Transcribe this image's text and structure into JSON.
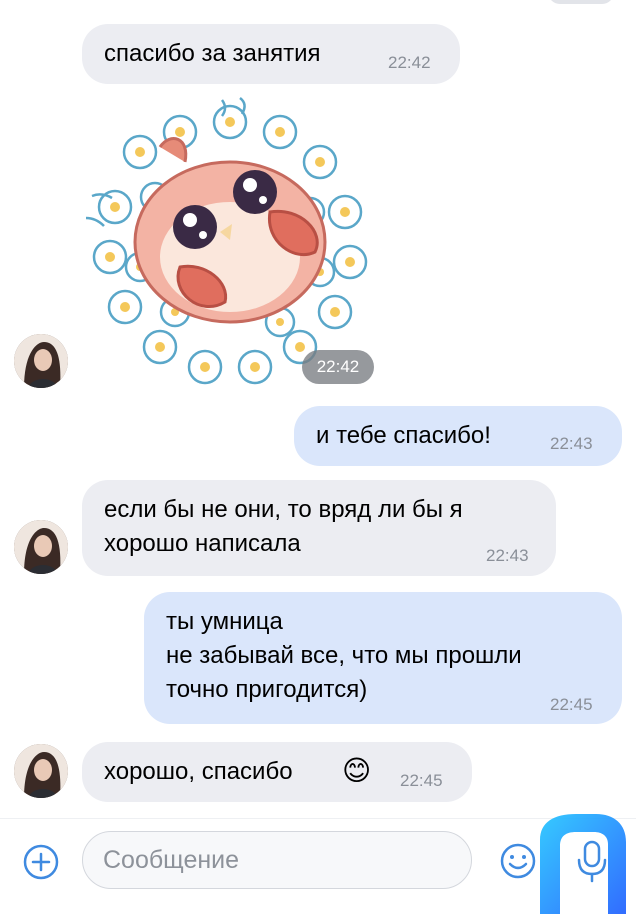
{
  "messages": [
    {
      "text": "спасибо за занятия",
      "time": "22:42"
    },
    {
      "sticker_time": "22:42"
    },
    {
      "text": "и тебе спасибо!",
      "time": "22:43"
    },
    {
      "line1": "если бы не они, то вряд ли бы я",
      "line2": "хорошо написала",
      "time": "22:43"
    },
    {
      "line1": "ты умница",
      "line2": "не забывай все, что мы прошли",
      "line3": "точно пригодится)",
      "time": "22:45"
    },
    {
      "text": "хорошо, спасибо",
      "emoji": "😊",
      "time": "22:45"
    }
  ],
  "composer": {
    "placeholder": "Сообщение"
  },
  "icons": {
    "add": "plus-circle-icon",
    "emoji": "smiley-icon",
    "mic": "microphone-icon"
  },
  "colors": {
    "incoming_bubble": "#ecedf2",
    "outgoing_bubble": "#dae6fb",
    "accent": "#3f8ae0"
  }
}
